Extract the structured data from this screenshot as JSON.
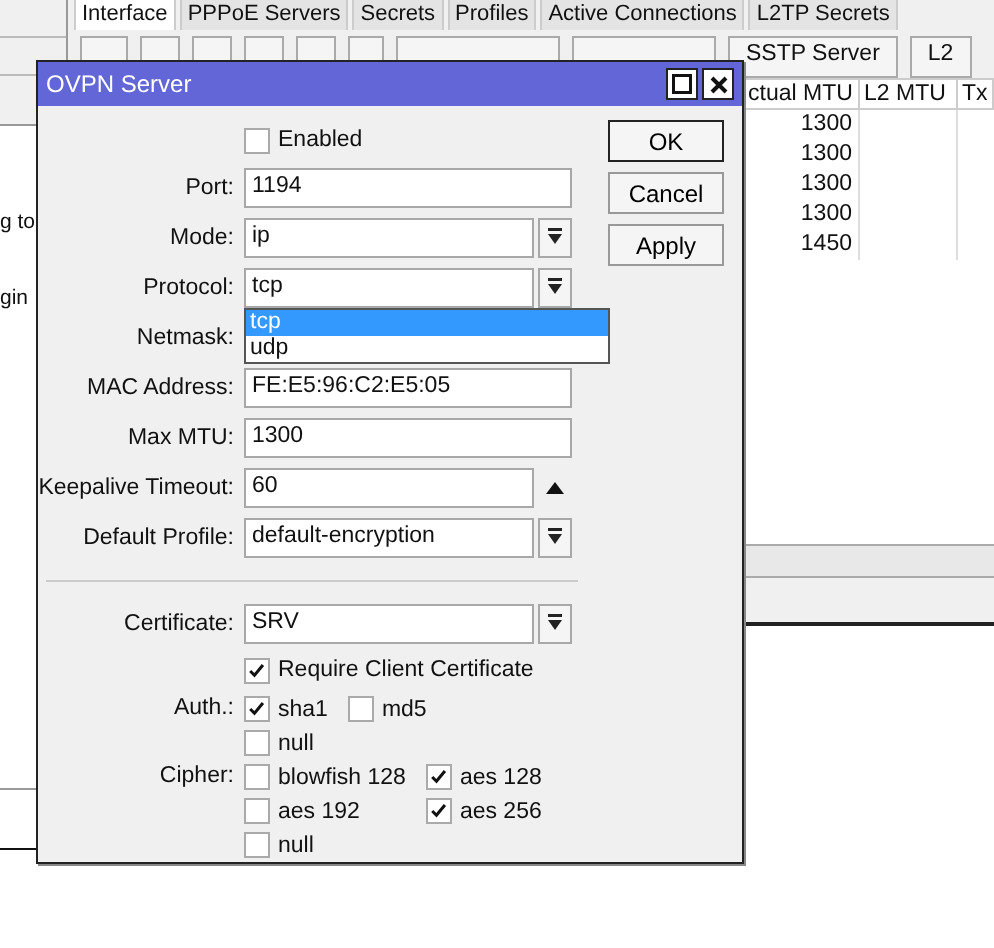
{
  "background_window": {
    "tabs": [
      {
        "label": "Interface",
        "selected": true
      },
      {
        "label": "PPPoE Servers",
        "selected": false
      },
      {
        "label": "Secrets",
        "selected": false
      },
      {
        "label": "Profiles",
        "selected": false
      },
      {
        "label": "Active Connections",
        "selected": false
      },
      {
        "label": "L2TP Secrets",
        "selected": false
      }
    ],
    "toolbar_buttons": [
      "SSTP Server",
      "L2"
    ],
    "table": {
      "columns": [
        "ctual MTU",
        "L2 MTU",
        "Tx"
      ],
      "rows": [
        [
          "1300"
        ],
        [
          "1300"
        ],
        [
          "1300"
        ],
        [
          "1300"
        ],
        [
          "1450"
        ]
      ]
    }
  },
  "left_window_texts": [
    "g to",
    "gin"
  ],
  "dialog": {
    "title": "OVPN Server",
    "buttons": [
      {
        "label": "OK",
        "default": true
      },
      {
        "label": "Cancel",
        "default": false
      },
      {
        "label": "Apply",
        "default": false
      }
    ],
    "rows": [
      {
        "kind": "checkbox",
        "label": "Enabled",
        "checked": false
      },
      {
        "kind": "text",
        "label": "Port:",
        "value": "1194"
      },
      {
        "kind": "select",
        "label": "Mode:",
        "value": "ip"
      },
      {
        "kind": "select",
        "label": "Protocol:",
        "value": "tcp",
        "options": [
          {
            "label": "tcp",
            "selected": true
          },
          {
            "label": "udp",
            "selected": false
          }
        ]
      },
      {
        "kind": "covered",
        "label": "Netmask:"
      },
      {
        "kind": "text",
        "label": "MAC Address:",
        "value": "FE:E5:96:C2:E5:05"
      },
      {
        "kind": "text",
        "label": "Max MTU:",
        "value": "1300"
      },
      {
        "kind": "spin",
        "label": "Keepalive Timeout:",
        "value": "60"
      },
      {
        "kind": "select",
        "label": "Default Profile:",
        "value": "default-encryption"
      },
      {
        "kind": "separator"
      },
      {
        "kind": "select",
        "label": "Certificate:",
        "value": "SRV"
      },
      {
        "kind": "checkbox",
        "label": "Require Client Certificate",
        "checked": true
      },
      {
        "kind": "checks",
        "label": "Auth.:",
        "options": [
          {
            "label": "sha1",
            "checked": true
          },
          {
            "label": "md5",
            "checked": false
          },
          {
            "label": "null",
            "checked": false
          }
        ]
      },
      {
        "kind": "checks",
        "label": "Cipher:",
        "options": [
          {
            "label": "blowfish 128",
            "checked": false
          },
          {
            "label": "aes 128",
            "checked": true
          },
          {
            "label": "aes 192",
            "checked": false
          },
          {
            "label": "aes 256",
            "checked": true
          },
          {
            "label": "null",
            "checked": false
          }
        ]
      }
    ]
  }
}
